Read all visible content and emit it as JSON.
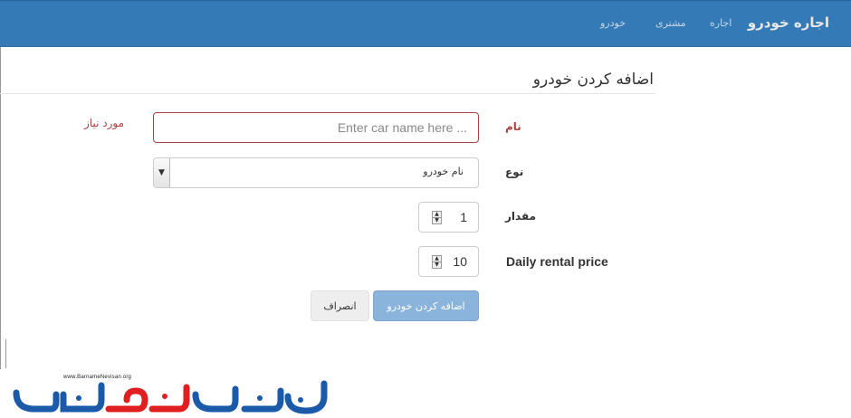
{
  "navbar": {
    "brand": "اجاره خودرو",
    "links": [
      "اجاره",
      "مشتری",
      "خودرو"
    ]
  },
  "page": {
    "title": "اضافه کردن خودرو"
  },
  "form": {
    "name_label": "نام",
    "name_placeholder": "Enter car name here ...",
    "name_required": "مورد نیاز",
    "type_label": "نوع",
    "type_value": "نام خودرو",
    "amount_label": "مقدار",
    "amount_value": "1",
    "price_label": "Daily rental price",
    "price_value": "10",
    "submit_label": "اضافه کردن خودرو",
    "cancel_label": "انصراف"
  },
  "logo": {
    "url_text": "www.BarnameNevisan.org",
    "wordmark": "برنامه نویسان"
  },
  "colors": {
    "navbar": "#337ab7",
    "error": "#a94442",
    "logo_blue": "#1a5aa8",
    "logo_red": "#e02020"
  }
}
